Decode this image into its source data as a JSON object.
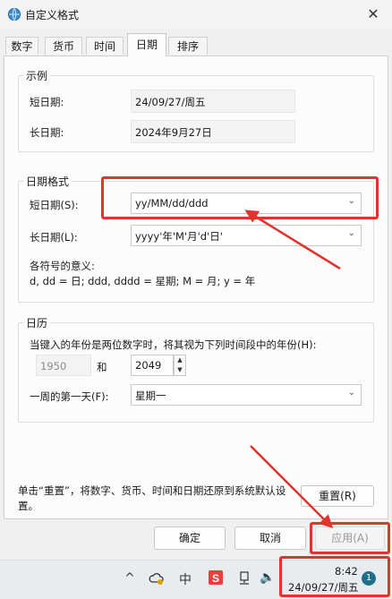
{
  "window": {
    "title": "自定义格式",
    "close_glyph": "✕"
  },
  "tabs": [
    {
      "label": "数字"
    },
    {
      "label": "货币"
    },
    {
      "label": "时间"
    },
    {
      "label": "日期",
      "active": true
    },
    {
      "label": "排序"
    }
  ],
  "example": {
    "group_title": "示例",
    "short_label": "短日期:",
    "short_value": "24/09/27/周五",
    "long_label": "长日期:",
    "long_value": "2024年9月27日"
  },
  "date_formats": {
    "group_title": "日期格式",
    "short_label": "短日期(S):",
    "short_value": "yy/MM/dd/ddd",
    "long_label": "长日期(L):",
    "long_value": "yyyy'年'M'月'd'日'",
    "symbols_title": "各符号的意义:",
    "symbols_text": "d, dd = 日;  ddd, dddd = 星期;  M = 月;  y = 年"
  },
  "calendar": {
    "group_title": "日历",
    "two_digit_text": "当键入的年份是两位数字时，将其视为下列时间段中的年份(H):",
    "year_from": "1950",
    "and_label": "和",
    "year_to": "2049",
    "first_day_label": "一周的第一天(F):",
    "first_day_value": "星期一"
  },
  "reset": {
    "text_line1": "单击“重置”，将数字、货币、时间和日期还原到系统默认设置。",
    "text_line2": "置。",
    "button_label": "重置(R)"
  },
  "footer": {
    "ok_label": "确定",
    "cancel_label": "取消",
    "apply_label": "应用(A)"
  },
  "taskbar": {
    "time": "8:42",
    "date": "24/09/27/周五",
    "badge": "1",
    "chevron_glyph": "^",
    "ime_glyph": "中",
    "speaker_glyph": "🔈"
  },
  "colors": {
    "highlight": "#e0342c",
    "accent": "#0067c0"
  }
}
